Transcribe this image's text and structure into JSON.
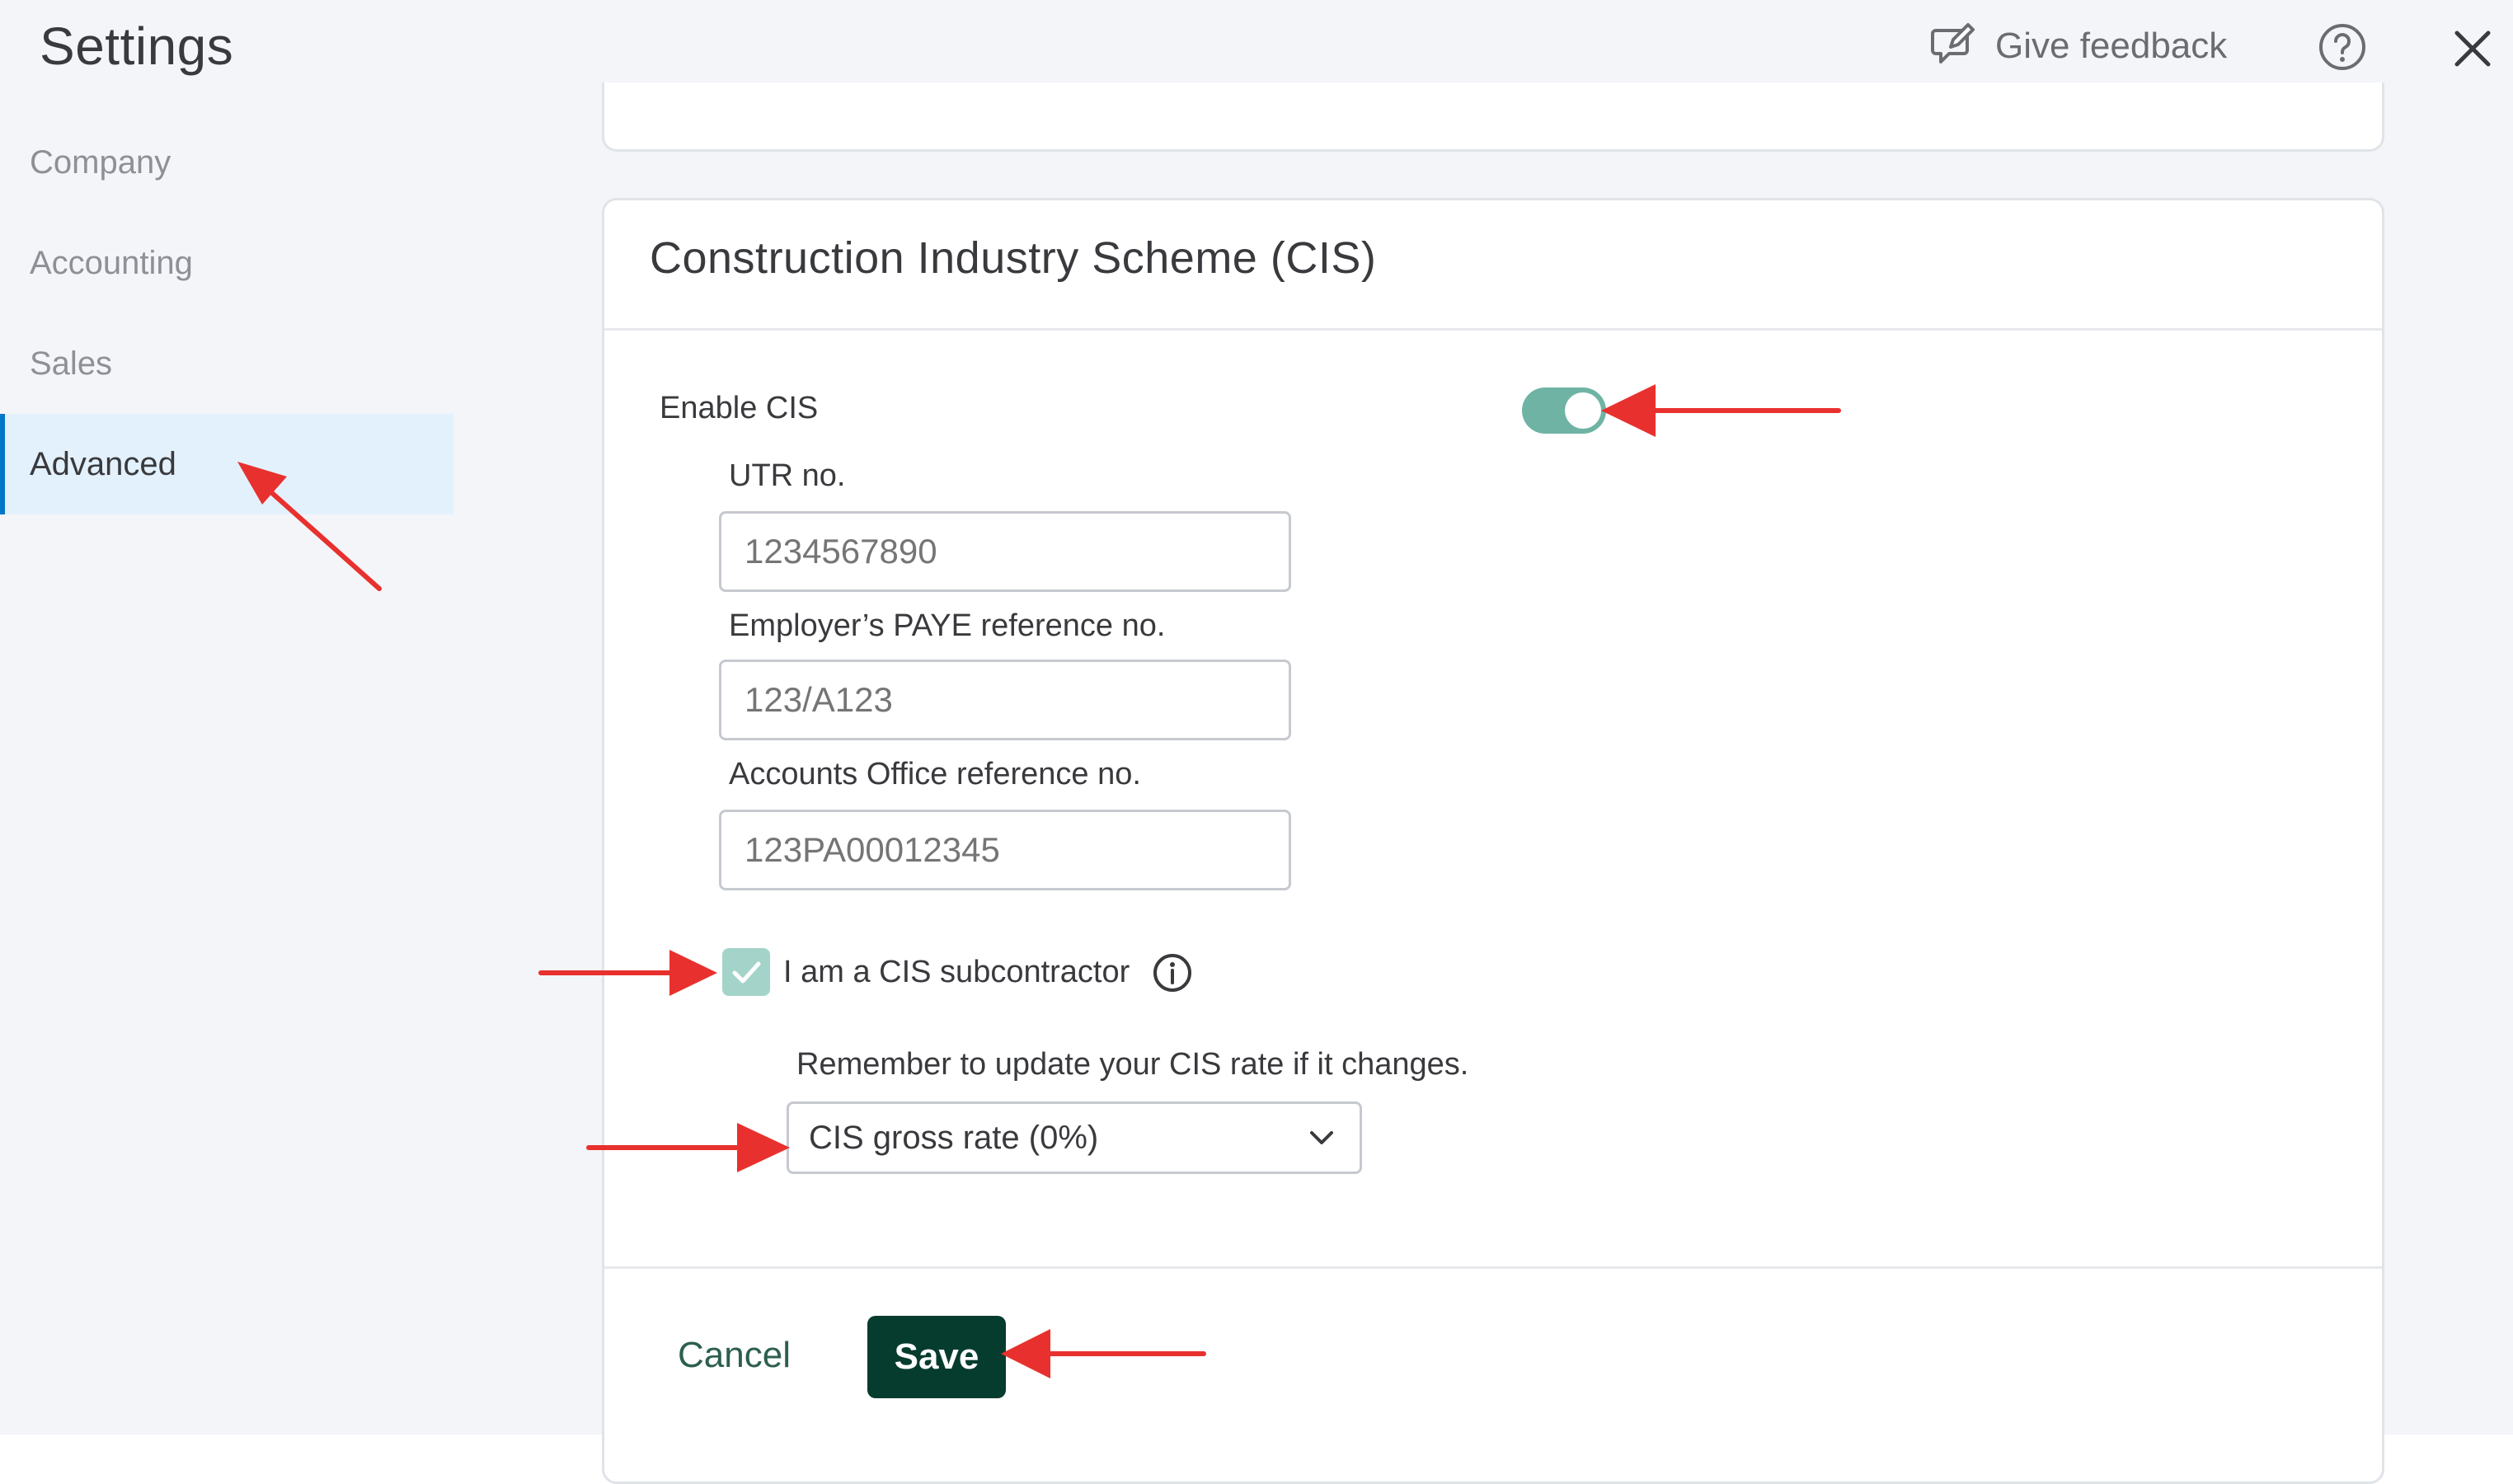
{
  "header": {
    "title": "Settings",
    "feedback_label": "Give feedback",
    "icons": {
      "feedback": "feedback-icon",
      "help": "help-icon",
      "close": "close-icon"
    }
  },
  "sidebar": {
    "items": [
      {
        "label": "Company",
        "active": false
      },
      {
        "label": "Accounting",
        "active": false
      },
      {
        "label": "Sales",
        "active": false
      },
      {
        "label": "Advanced",
        "active": true
      }
    ]
  },
  "cis": {
    "section_title": "Construction Industry Scheme (CIS)",
    "enable_label": "Enable CIS",
    "enable_state": true,
    "utr_label": "UTR no.",
    "utr_placeholder": "1234567890",
    "paye_label": "Employer’s PAYE reference no.",
    "paye_placeholder": "123/A123",
    "aor_label": "Accounts Office reference no.",
    "aor_placeholder": "123PA00012345",
    "subcontractor_label": "I am a CIS subcontractor",
    "subcontractor_checked": true,
    "rate_note": "Remember to update your CIS rate if it changes.",
    "rate_selected": "CIS gross rate (0%)"
  },
  "footer": {
    "cancel_label": "Cancel",
    "save_label": "Save"
  },
  "colors": {
    "accent_green": "#063c2e",
    "toggle_on": "#6fb3a4",
    "active_nav_bg": "#e3f1fc",
    "annotation_red": "#e8312e"
  }
}
